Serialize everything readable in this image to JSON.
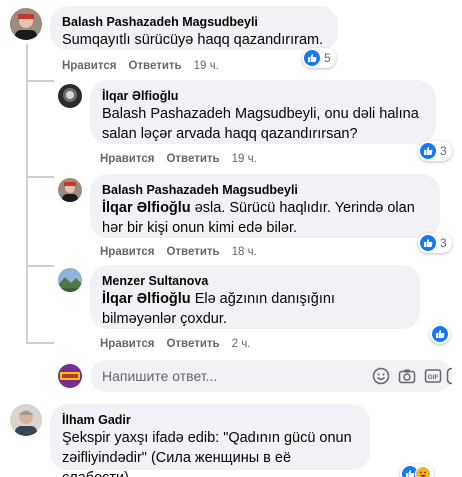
{
  "comments": [
    {
      "author": "Balash Pashazadeh Magsudbeyli",
      "text": "Sumqayıtlı sürücüyə haqq qazandırıram.",
      "like_label": "Нравится",
      "reply_label": "Ответить",
      "time": "19 ч.",
      "reactions": "5"
    },
    {
      "author": "İlqar Əlfioğlu",
      "text": "Balash Pashazadeh Magsudbeyli, onu dəli halına salan ləçər arvada haqq qazandırırsan?",
      "like_label": "Нравится",
      "reply_label": "Ответить",
      "time": "19 ч.",
      "reactions": "3"
    },
    {
      "author": "Balash Pashazadeh Magsudbeyli",
      "mention": "İlqar Əlfioğlu",
      "text": " əsla. Sürücü haqlıdır. Yerində olan hər bir kişi onun kimi edə bilər.",
      "like_label": "Нравится",
      "reply_label": "Ответить",
      "time": "18 ч.",
      "reactions": "3"
    },
    {
      "author": "Menzer Sultanova",
      "mention": "İlqar Əlfioğlu",
      "text": " Elə ağzının danışığını bilməyənlər çoxdur.",
      "like_label": "Нравится",
      "reply_label": "Ответить",
      "time": "2 ч."
    },
    {
      "author": "İlham Gadir",
      "text": "Şekspir yaxşı ifadə edib: \"Qadının gücü onun zəifliyindədir\" (Сила женщины в её слабости)"
    }
  ],
  "reply_box": {
    "placeholder": "Напишите ответ..."
  },
  "colors": {
    "bubble": "#f0f2f5",
    "like_blue": "#1877f2",
    "meta_gray": "#65676b"
  }
}
